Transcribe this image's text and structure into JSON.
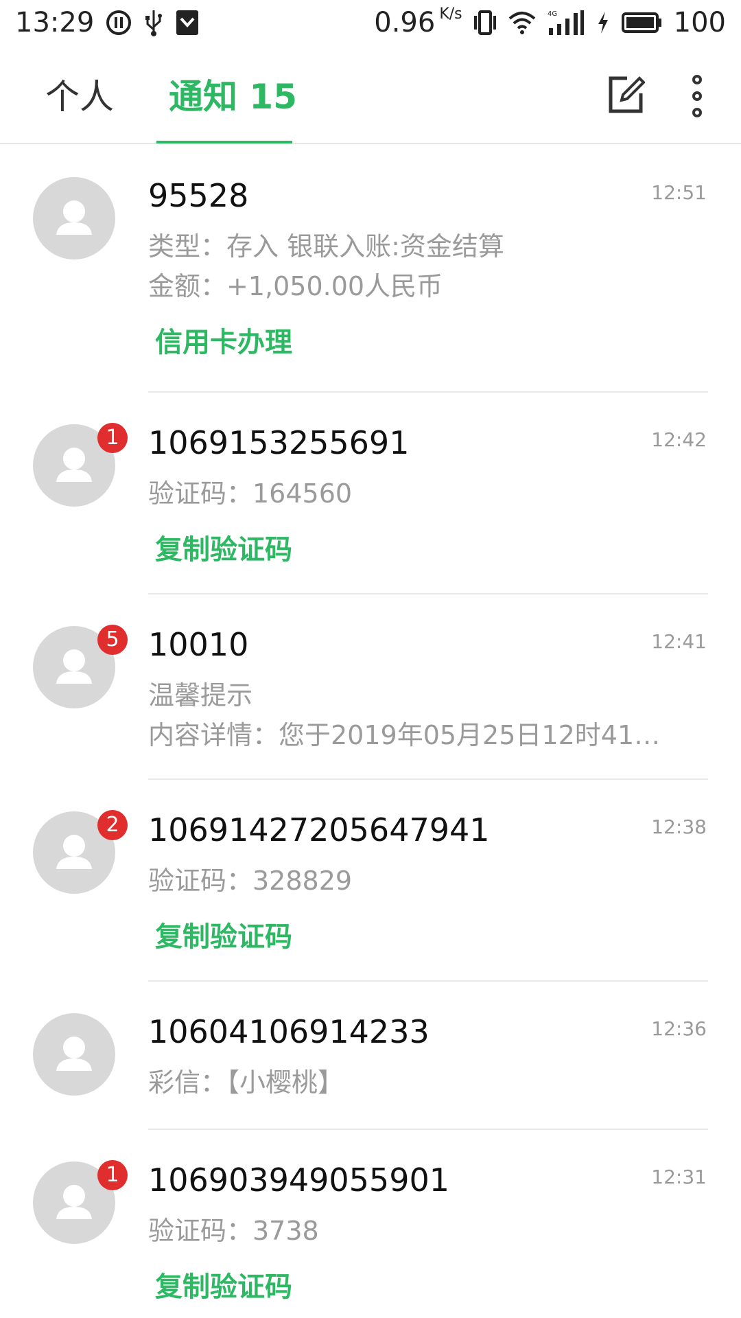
{
  "status_bar": {
    "time": "13:29",
    "speed_value": "0.96",
    "speed_unit": "K/s",
    "battery": "100",
    "icons": [
      "pause-circle-icon",
      "usb-icon",
      "shield-icon",
      "vibrate-icon",
      "wifi-icon",
      "signal-4g-icon",
      "charging-icon",
      "battery-icon"
    ]
  },
  "tabs": [
    {
      "label": "个人"
    },
    {
      "label": "通知 15"
    }
  ],
  "colors": {
    "accent": "#2fb864",
    "badge": "#e02d2d"
  },
  "messages": [
    {
      "sender": "95528",
      "time": "12:51",
      "lines": [
        "类型：存入 银联入账:资金结算",
        "金额：+1,050.00人民币"
      ],
      "action": "信用卡办理",
      "badge": ""
    },
    {
      "sender": "1069153255691",
      "time": "12:42",
      "lines": [
        "验证码：164560"
      ],
      "action": "复制验证码",
      "badge": "1"
    },
    {
      "sender": "10010",
      "time": "12:41",
      "lines": [
        "温馨提示",
        "内容详情：您于2019年05月25日12时41…"
      ],
      "action": "",
      "badge": "5"
    },
    {
      "sender": "10691427205647941",
      "time": "12:38",
      "lines": [
        "验证码：328829"
      ],
      "action": "复制验证码",
      "badge": "2"
    },
    {
      "sender": "10604106914233",
      "time": "12:36",
      "lines": [
        "彩信：【小樱桃】"
      ],
      "action": "",
      "badge": ""
    },
    {
      "sender": "106903949055901",
      "time": "12:31",
      "lines": [
        "验证码：3738"
      ],
      "action": "复制验证码",
      "badge": "1"
    }
  ]
}
